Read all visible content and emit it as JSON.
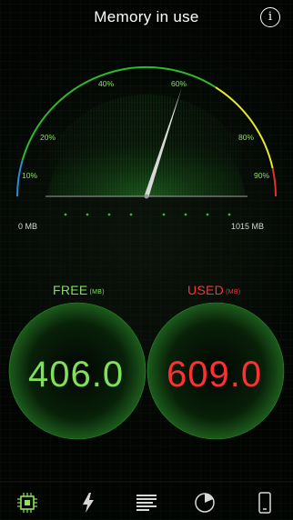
{
  "header": {
    "title": "Memory in use",
    "info_icon": "info-icon"
  },
  "gauge": {
    "min_label": "0 MB",
    "max_label": "1015 MB",
    "percent_marks": [
      "10%",
      "20%",
      "40%",
      "60%",
      "80%",
      "90%"
    ],
    "needle_percent": 0.6,
    "colors": {
      "low": "#2c8ad6",
      "mid": "#2fb82c",
      "high": "#e8e82a",
      "max": "#e53030"
    }
  },
  "free": {
    "label": "FREE",
    "unit": "(MB)",
    "value": "406.0",
    "color": "#7fe05a"
  },
  "used": {
    "label": "USED",
    "unit": "(MB)",
    "value": "609.0",
    "color": "#ff3030"
  },
  "tabs": [
    {
      "name": "memory-tab",
      "icon": "chip-icon",
      "active": true
    },
    {
      "name": "power-tab",
      "icon": "lightning-icon",
      "active": false
    },
    {
      "name": "list-tab",
      "icon": "list-icon",
      "active": false
    },
    {
      "name": "disk-tab",
      "icon": "pie-icon",
      "active": false
    },
    {
      "name": "device-tab",
      "icon": "phone-icon",
      "active": false
    }
  ]
}
